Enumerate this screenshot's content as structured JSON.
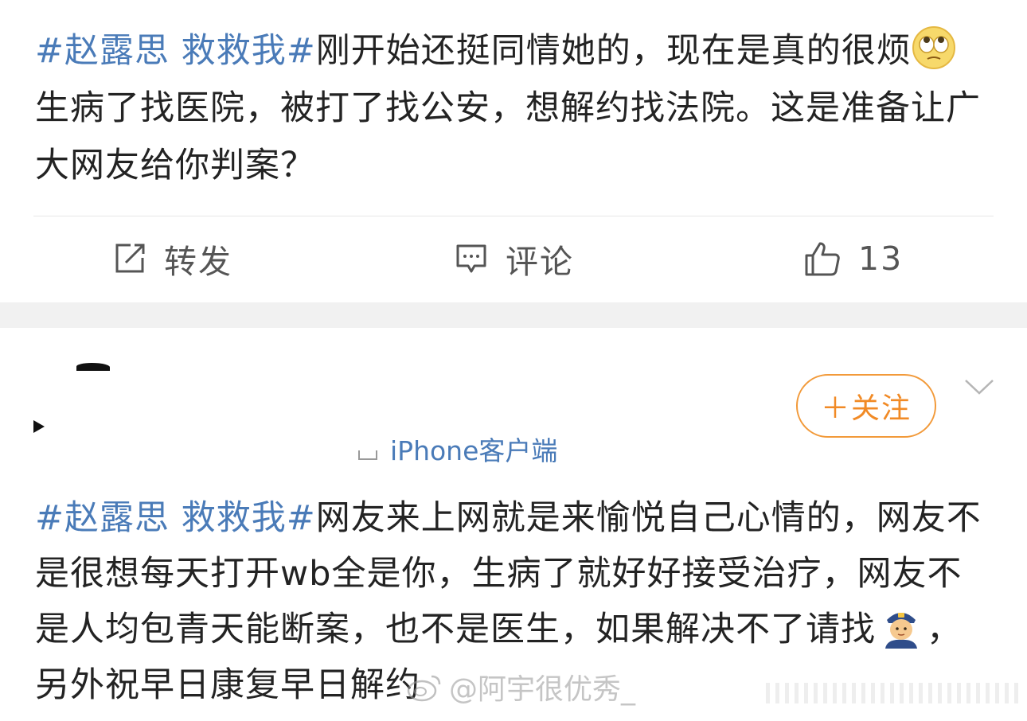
{
  "post1": {
    "topic": "#赵露思 救救我#",
    "text_part1": "刚开始还挺同情她的，现在是真的很烦",
    "text_part2": "生病了找医院，被打了找公安，想解约找法院。这是准备让广大网友给你判案？",
    "emoji": "eye-roll-emoji"
  },
  "actions": {
    "repost_label": "转发",
    "comment_label": "评论",
    "like_count": "13"
  },
  "post2": {
    "source": "iPhone客户端",
    "follow_label": "＋关注",
    "topic": "#赵露思 救救我#",
    "text_part1": "网友来上网就是来愉悦自己心情的，网友不是很想每天打开wb全是你，生病了就好好接受治疗，网友不是人均包青天能断案，也不是医生，如果解决不了请找",
    "emoji": "police-officer-emoji",
    "text_part2": "，另外祝早日康复早日解约"
  },
  "watermark": {
    "text": "@阿宇很优秀_"
  },
  "colors": {
    "topic": "#4a7bb8",
    "follow": "#f18a25",
    "gap": "#f1f1f1"
  }
}
